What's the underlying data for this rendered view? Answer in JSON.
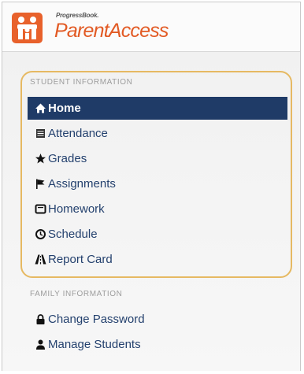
{
  "header": {
    "brand_small": "ProgressBook.",
    "brand_main": "ParentAccess",
    "logo_color": "#e8612b"
  },
  "student_section": {
    "label": "STUDENT INFORMATION",
    "items": [
      {
        "label": "Home",
        "icon": "home-icon",
        "active": true
      },
      {
        "label": "Attendance",
        "icon": "list-icon",
        "active": false
      },
      {
        "label": "Grades",
        "icon": "star-icon",
        "active": false
      },
      {
        "label": "Assignments",
        "icon": "flag-icon",
        "active": false
      },
      {
        "label": "Homework",
        "icon": "book-icon",
        "active": false
      },
      {
        "label": "Schedule",
        "icon": "clock-icon",
        "active": false
      },
      {
        "label": "Report Card",
        "icon": "road-icon",
        "active": false
      }
    ]
  },
  "family_section": {
    "label": "FAMILY INFORMATION",
    "items": [
      {
        "label": "Change Password",
        "icon": "lock-icon"
      },
      {
        "label": "Manage Students",
        "icon": "user-icon"
      }
    ]
  },
  "colors": {
    "active_bg": "#1f3b67",
    "link": "#24416e",
    "highlight_border": "#e6b962",
    "brand": "#e25a24"
  }
}
